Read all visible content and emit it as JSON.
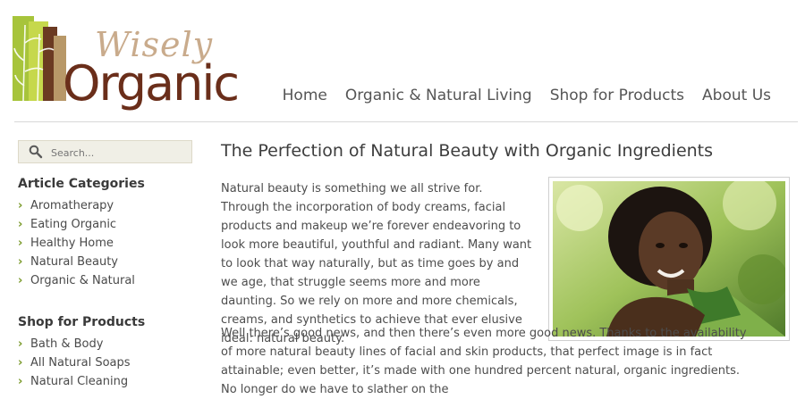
{
  "brand": {
    "line1": "Wisely",
    "line2": "Organic"
  },
  "nav": [
    {
      "label": "Home"
    },
    {
      "label": "Organic & Natural Living"
    },
    {
      "label": "Shop for Products"
    },
    {
      "label": "About Us"
    }
  ],
  "search": {
    "placeholder": "Search..."
  },
  "sidebar": {
    "article_categories": {
      "heading": "Article Categories",
      "items": [
        "Aromatherapy",
        "Eating Organic",
        "Healthy Home",
        "Natural Beauty",
        "Organic & Natural"
      ]
    },
    "shop": {
      "heading": "Shop for Products",
      "items": [
        "Bath & Body",
        "All Natural Soaps",
        "Natural Cleaning"
      ]
    }
  },
  "article": {
    "title": "The Perfection of Natural Beauty with Organic Ingredients",
    "p1": "Natural beauty is something we all strive for. Through the incorporation of body creams, facial products and makeup we’re forever endeavoring to look more beautiful, youthful and radiant. Many want to look that way naturally, but as time goes by and we age, that struggle seems more and more daunting. So we rely on more and more chemicals, creams, and synthetics to achieve that ever elusive ideal: natural beauty.",
    "p2": "Well there’s good news, and then there’s even more good news. Thanks to the availability of more natural beauty lines of facial and skin products, that perfect image is in fact attainable; even better, it’s made with one hundred percent natural, organic ingredients. No longer do we have to slather on the"
  },
  "colors": {
    "accent_green": "#7a9a2a",
    "brand_brown": "#6a2e1a",
    "brand_tan": "#c9ab8c"
  }
}
